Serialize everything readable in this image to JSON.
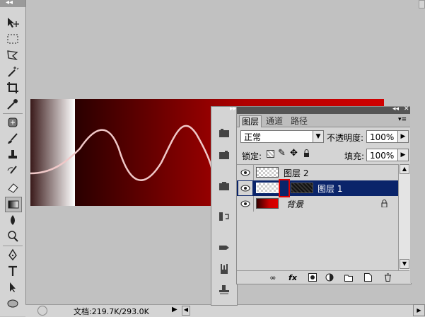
{
  "tools_panel": {
    "collapse_label": "◂◂"
  },
  "layers_panel": {
    "collapse_label": "▸▸",
    "tabs": [
      {
        "label": "图层"
      },
      {
        "label": "通道"
      },
      {
        "label": "路径"
      }
    ],
    "blend_mode": "正常",
    "opacity_label": "不透明度:",
    "opacity_value": "100%",
    "lock_label": "锁定:",
    "fill_label": "填充:",
    "fill_value": "100%",
    "layers": [
      {
        "name": "图层 2",
        "selected": false
      },
      {
        "name": "图层 1",
        "selected": true
      },
      {
        "name": "背景",
        "selected": false
      }
    ]
  },
  "status_bar": {
    "doc_info": "文档:219.7K/293.0K"
  },
  "colors": {
    "canvas_red": "#c00000",
    "selection_bg": "#0a246a",
    "highlight_box": "#e00000"
  }
}
